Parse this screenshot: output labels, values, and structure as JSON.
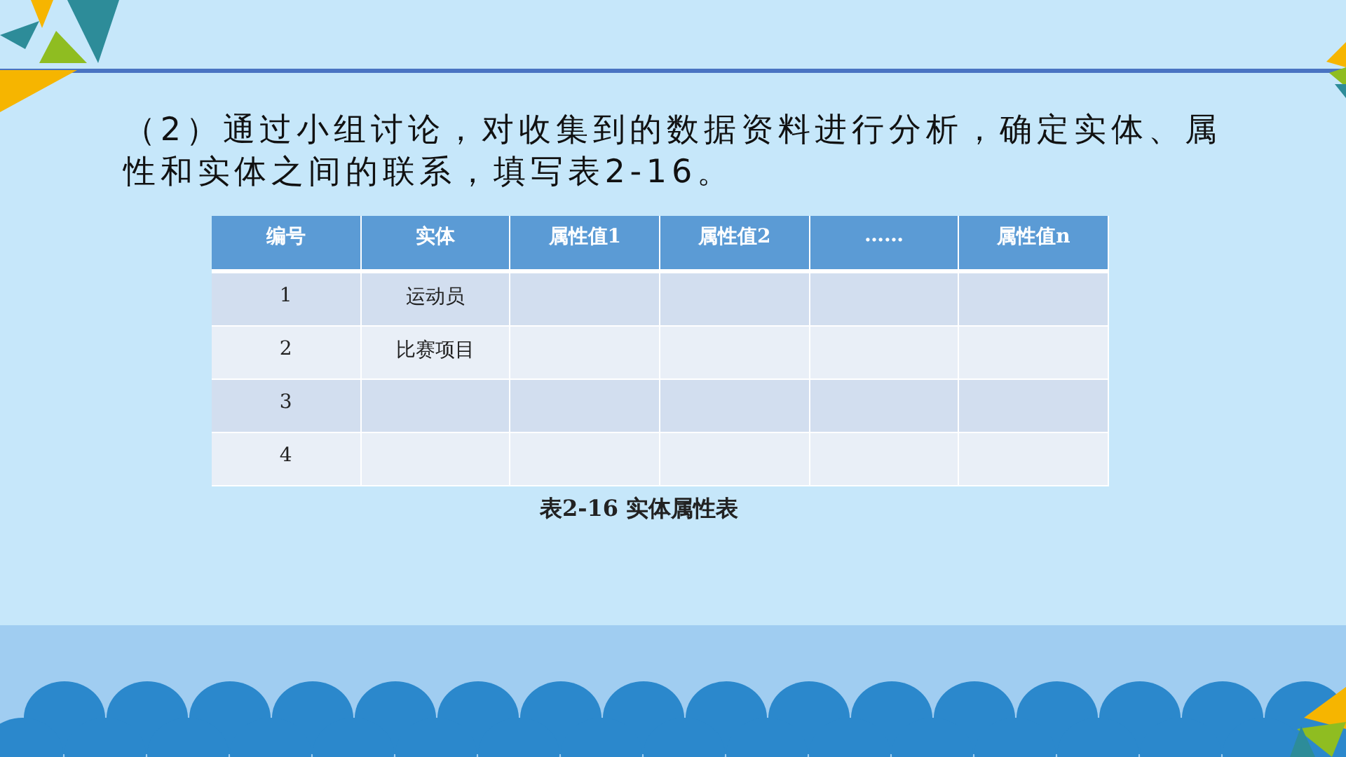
{
  "instruction": "（2）通过小组讨论，对收集到的数据资料进行分析，确定实体、属性和实体之间的联系，填写表2-16。",
  "table": {
    "columns": [
      "编号",
      "实体",
      "属性值1",
      "属性值2",
      "……",
      "属性值n"
    ],
    "rows": [
      {
        "cells": [
          "1",
          "运动员"
        ]
      },
      {
        "cells": [
          "2",
          "比赛项目"
        ]
      },
      {
        "cells": [
          "3"
        ]
      },
      {
        "cells": [
          "4"
        ]
      }
    ],
    "caption": "表2-16 实体属性表"
  }
}
